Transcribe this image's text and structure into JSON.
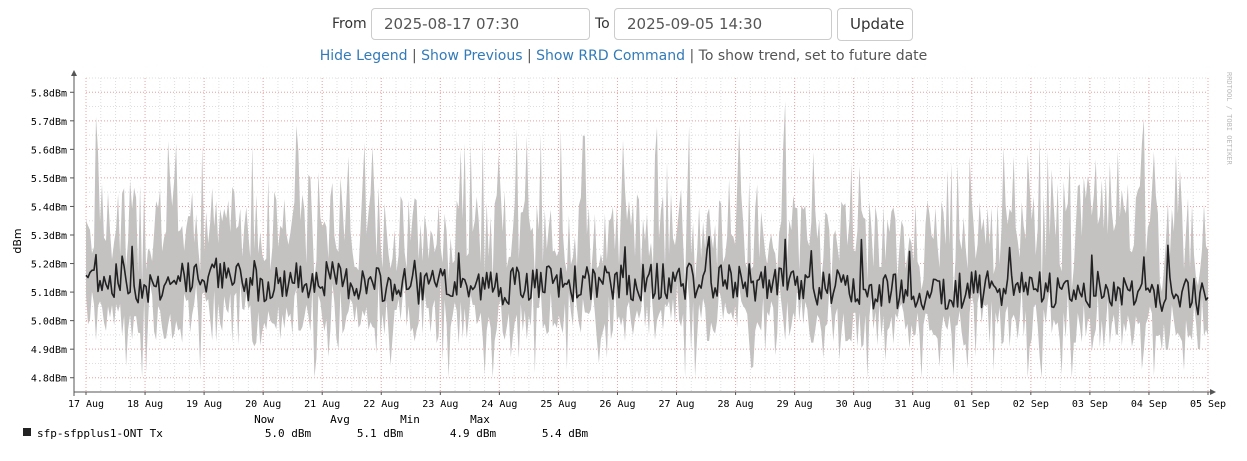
{
  "controls": {
    "from_label": "From",
    "from_value": "2025-08-17 07:30",
    "to_label": "To",
    "to_value": "2025-09-05 14:30",
    "update_label": "Update"
  },
  "links": {
    "hide_legend": "Hide Legend",
    "show_previous": "Show Previous",
    "show_rrd_command": "Show RRD Command",
    "separator": "|",
    "trend_note": "To show trend, set to future date"
  },
  "watermark": "RRDTOOL / TOBI OETIKER",
  "colors": {
    "line": "#222222",
    "band": "#c4c1c1",
    "grid": "#dedede",
    "major_grid": "#f2a3a3",
    "axis": "#555555"
  },
  "chart_data": {
    "type": "area",
    "ylabel": "dBm",
    "ylim": [
      4.75,
      5.85
    ],
    "y_ticks": [
      {
        "value": 4.8,
        "label": "4.8dBm"
      },
      {
        "value": 4.9,
        "label": "4.9dBm"
      },
      {
        "value": 5.0,
        "label": "5.0dBm"
      },
      {
        "value": 5.1,
        "label": "5.1dBm"
      },
      {
        "value": 5.2,
        "label": "5.2dBm"
      },
      {
        "value": 5.3,
        "label": "5.3dBm"
      },
      {
        "value": 5.4,
        "label": "5.4dBm"
      },
      {
        "value": 5.5,
        "label": "5.5dBm"
      },
      {
        "value": 5.6,
        "label": "5.6dBm"
      },
      {
        "value": 5.7,
        "label": "5.7dBm"
      },
      {
        "value": 5.8,
        "label": "5.8dBm"
      }
    ],
    "x_ticks": [
      "17 Aug",
      "18 Aug",
      "19 Aug",
      "20 Aug",
      "21 Aug",
      "22 Aug",
      "23 Aug",
      "24 Aug",
      "25 Aug",
      "26 Aug",
      "27 Aug",
      "28 Aug",
      "29 Aug",
      "30 Aug",
      "31 Aug",
      "01 Sep",
      "02 Sep",
      "03 Sep",
      "04 Sep",
      "05 Sep"
    ],
    "grid": true,
    "legend_position": "bottom-left",
    "series": [
      {
        "name": "sfp-sfpplus1-ONT Tx",
        "color": "#222222",
        "points": [
          {
            "x": "17 Aug",
            "avg": 5.16,
            "min": 5.0,
            "max": 5.45
          },
          {
            "x": "18 Aug",
            "avg": 5.12,
            "min": 4.95,
            "max": 5.5
          },
          {
            "x": "19 Aug",
            "avg": 5.15,
            "min": 4.95,
            "max": 5.45
          },
          {
            "x": "20 Aug",
            "avg": 5.13,
            "min": 4.93,
            "max": 5.5
          },
          {
            "x": "21 Aug",
            "avg": 5.15,
            "min": 4.95,
            "max": 5.5
          },
          {
            "x": "22 Aug",
            "avg": 5.12,
            "min": 4.96,
            "max": 5.45
          },
          {
            "x": "23 Aug",
            "avg": 5.12,
            "min": 4.94,
            "max": 5.4
          },
          {
            "x": "24 Aug",
            "avg": 5.12,
            "min": 4.95,
            "max": 5.45
          },
          {
            "x": "25 Aug",
            "avg": 5.13,
            "min": 4.96,
            "max": 5.42
          },
          {
            "x": "26 Aug",
            "avg": 5.13,
            "min": 4.95,
            "max": 5.45
          },
          {
            "x": "27 Aug",
            "avg": 5.14,
            "min": 4.96,
            "max": 5.45
          },
          {
            "x": "28 Aug",
            "avg": 5.13,
            "min": 4.95,
            "max": 5.5
          },
          {
            "x": "29 Aug",
            "avg": 5.12,
            "min": 4.95,
            "max": 5.45
          },
          {
            "x": "30 Aug",
            "avg": 5.11,
            "min": 4.93,
            "max": 5.4
          },
          {
            "x": "31 Aug",
            "avg": 5.1,
            "min": 4.93,
            "max": 5.4
          },
          {
            "x": "01 Sep",
            "avg": 5.11,
            "min": 4.93,
            "max": 5.45
          },
          {
            "x": "02 Sep",
            "avg": 5.11,
            "min": 4.93,
            "max": 5.45
          },
          {
            "x": "03 Sep",
            "avg": 5.11,
            "min": 4.92,
            "max": 5.5
          },
          {
            "x": "04 Sep",
            "avg": 5.1,
            "min": 4.92,
            "max": 5.45
          },
          {
            "x": "05 Sep",
            "avg": 5.08,
            "min": 4.92,
            "max": 5.4
          }
        ]
      }
    ],
    "legend": {
      "headers": [
        "Now",
        "Avg",
        "Min",
        "Max"
      ],
      "rows": [
        {
          "name": "sfp-sfpplus1-ONT Tx",
          "now": "5.0 dBm",
          "avg": "5.1 dBm",
          "min": "4.9 dBm",
          "max": "5.4 dBm"
        }
      ]
    }
  }
}
